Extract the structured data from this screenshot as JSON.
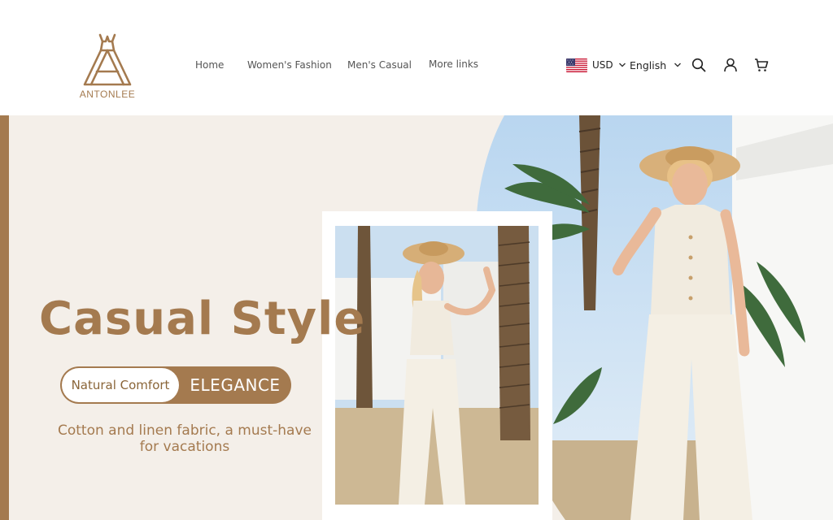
{
  "brand": {
    "name": "ANTONLEE",
    "color": "#a47a4f"
  },
  "nav": {
    "items": [
      {
        "label": "Home"
      },
      {
        "label": "Women's Fashion"
      },
      {
        "label": "Men's Casual"
      },
      {
        "label": "More links"
      }
    ]
  },
  "header_tools": {
    "currency": "USD",
    "currency_flag": "us-flag-icon",
    "language": "English",
    "icons": [
      "search-icon",
      "user-icon",
      "cart-icon"
    ]
  },
  "hero": {
    "title": "Casual Style",
    "badge_left": "Natural Comfort",
    "badge_right": "ELEGANCE",
    "subtitle": "Cotton and linen fabric, a must-have for vacations",
    "colors": {
      "accent": "#a47a4f",
      "background": "#f4efe9",
      "sky": "#cfe2f3"
    }
  }
}
